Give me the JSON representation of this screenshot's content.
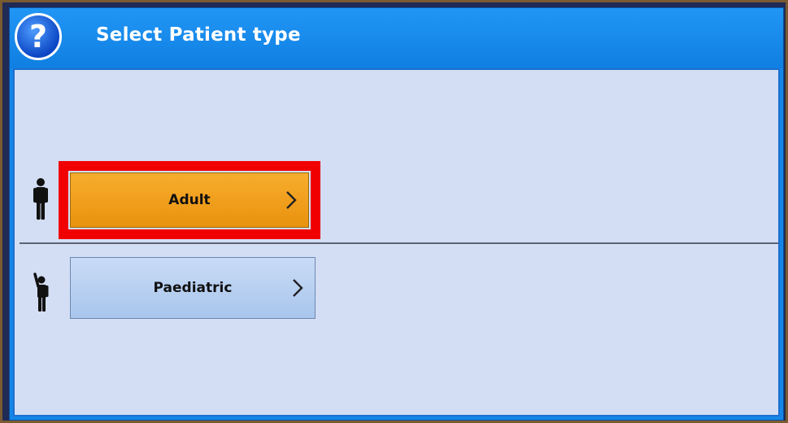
{
  "dialog": {
    "title": "Select Patient type",
    "help_icon": "question-mark-icon",
    "help_glyph": "?"
  },
  "options": [
    {
      "label": "Adult",
      "icon": "adult-person-icon",
      "arrow_icon": "chevron-right-icon",
      "selected": true,
      "button_color": "#f0a11d",
      "highlight_color": "#f00000"
    },
    {
      "label": "Paediatric",
      "icon": "child-person-icon",
      "arrow_icon": "chevron-right-icon",
      "selected": false,
      "button_color": "#bcd3f2"
    }
  ],
  "colors": {
    "title_bar": "#1586e8",
    "content_background": "#d3def4",
    "title_text": "#ffffff"
  }
}
